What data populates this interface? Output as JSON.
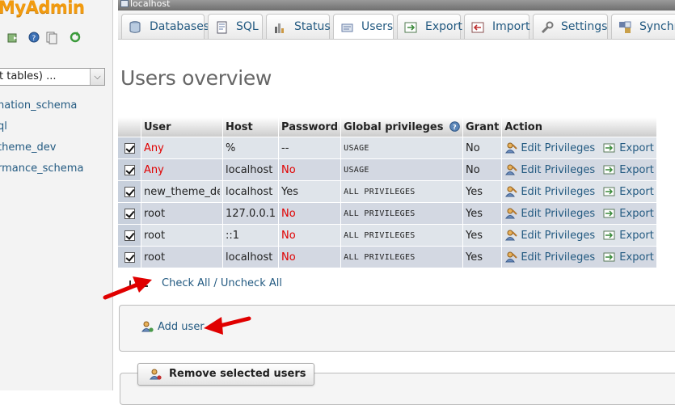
{
  "nav": {
    "logo": "MyAdmin",
    "db_select": "t tables) ...",
    "databases": [
      "nation_schema",
      "ql",
      "theme_dev",
      "rmance_schema"
    ]
  },
  "serverbar": {
    "server": "localhost"
  },
  "tabs": [
    {
      "label": "Databases",
      "icon": "database-icon"
    },
    {
      "label": "SQL",
      "icon": "sql-icon"
    },
    {
      "label": "Status",
      "icon": "status-chart-icon"
    },
    {
      "label": "Users",
      "icon": "users-icon"
    },
    {
      "label": "Export",
      "icon": "export-icon"
    },
    {
      "label": "Import",
      "icon": "import-icon"
    },
    {
      "label": "Settings",
      "icon": "wrench-icon"
    },
    {
      "label": "Synchro",
      "icon": "sync-icon"
    }
  ],
  "page_title": "Users overview",
  "table": {
    "headers": {
      "user": "User",
      "host": "Host",
      "password": "Password",
      "global": "Global privileges",
      "grant": "Grant",
      "action": "Action"
    },
    "rows": [
      {
        "user": "Any",
        "host": "%",
        "password": "--",
        "privileges": "USAGE",
        "grant": "No",
        "edit": "Edit Privileges",
        "export": "Export"
      },
      {
        "user": "Any",
        "host": "localhost",
        "password": "No",
        "privileges": "USAGE",
        "grant": "No",
        "edit": "Edit Privileges",
        "export": "Export"
      },
      {
        "user": "new_theme_dev",
        "host": "localhost",
        "password": "Yes",
        "privileges": "ALL PRIVILEGES",
        "grant": "Yes",
        "edit": "Edit Privileges",
        "export": "Export"
      },
      {
        "user": "root",
        "host": "127.0.0.1",
        "password": "No",
        "privileges": "ALL PRIVILEGES",
        "grant": "Yes",
        "edit": "Edit Privileges",
        "export": "Export"
      },
      {
        "user": "root",
        "host": "::1",
        "password": "No",
        "privileges": "ALL PRIVILEGES",
        "grant": "Yes",
        "edit": "Edit Privileges",
        "export": "Export"
      },
      {
        "user": "root",
        "host": "localhost",
        "password": "No",
        "privileges": "ALL PRIVILEGES",
        "grant": "Yes",
        "edit": "Edit Privileges",
        "export": "Export"
      }
    ]
  },
  "check_all": "Check All",
  "separator": " / ",
  "uncheck_all": "Uncheck All",
  "add_user": "Add user",
  "remove_selected": "Remove selected users",
  "colors": {
    "link": "#235a81",
    "red": "#e00000",
    "arrow": "#e00000",
    "logo": "#f29b0f"
  }
}
